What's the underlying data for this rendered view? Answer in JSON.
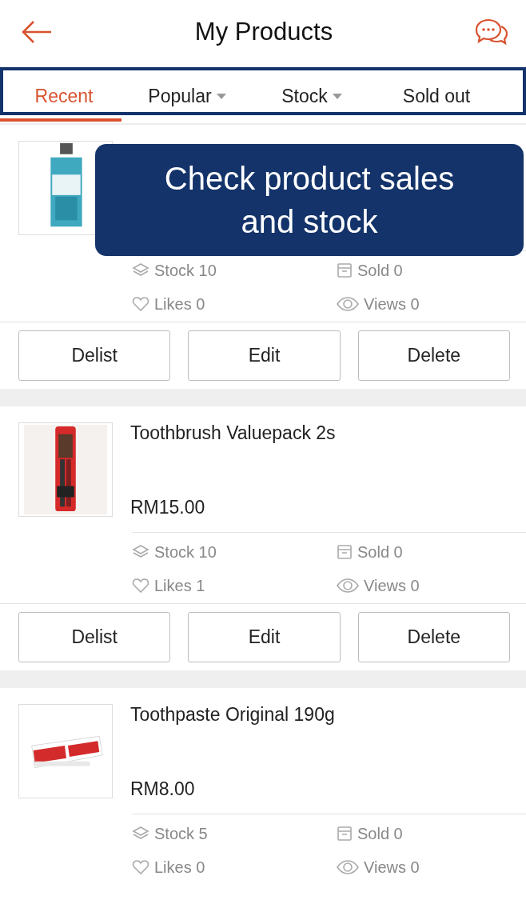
{
  "header": {
    "title": "My Products"
  },
  "tabs": [
    {
      "label": "Recent",
      "selected": true,
      "dropdown": false
    },
    {
      "label": "Popular",
      "selected": false,
      "dropdown": true
    },
    {
      "label": "Stock",
      "selected": false,
      "dropdown": true
    },
    {
      "label": "Sold out",
      "selected": false,
      "dropdown": false
    }
  ],
  "callout": {
    "text": "Check product sales and stock"
  },
  "products": [
    {
      "kind": "mouthwash",
      "stock": "Stock 10",
      "sold": "Sold 0",
      "likes": "Likes 0",
      "views": "Views 0",
      "buttons": [
        "Delist",
        "Edit",
        "Delete"
      ]
    },
    {
      "kind": "toothbrush",
      "name": "Toothbrush Valuepack 2s",
      "price": "RM15.00",
      "stock": "Stock 10",
      "sold": "Sold 0",
      "likes": "Likes 1",
      "views": "Views 0",
      "buttons": [
        "Delist",
        "Edit",
        "Delete"
      ]
    },
    {
      "kind": "toothpaste",
      "name": "Toothpaste Original 190g",
      "price": "RM8.00",
      "stock": "Stock 5",
      "sold": "Sold 0",
      "likes": "Likes 0",
      "views": "Views 0"
    }
  ]
}
